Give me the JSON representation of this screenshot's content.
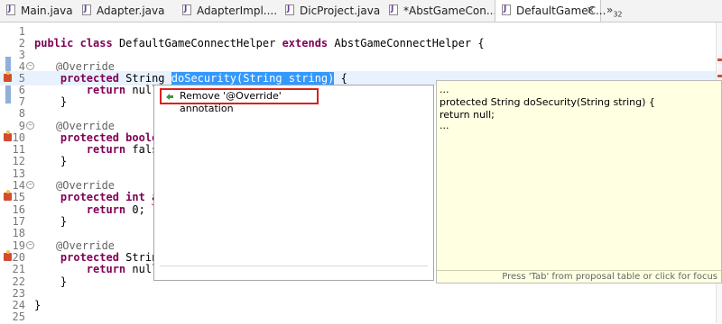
{
  "tabs": [
    {
      "label": "Main.java"
    },
    {
      "label": "Adapter.java"
    },
    {
      "label": "AdapterImpl...."
    },
    {
      "label": "DicProject.java"
    },
    {
      "label": "*AbstGameCon..."
    },
    {
      "label": "DefaultGameC...",
      "active": true
    }
  ],
  "tab_overflow": {
    "symbol": "»",
    "count": "32"
  },
  "editor": {
    "line_numbers": [
      "1",
      "2",
      "3",
      "4",
      "5",
      "6",
      "7",
      "8",
      "9",
      "10",
      "11",
      "12",
      "13",
      "14",
      "15",
      "16",
      "17",
      "18",
      "19",
      "20",
      "21",
      "22",
      "23",
      "24",
      "25"
    ],
    "l2": {
      "kw1": "public",
      "kw2": "class",
      "name": "DefaultGameConnectHelper",
      "kw3": "extends",
      "rest": "AbstGameConnectHelper {"
    },
    "l4": "@Override",
    "l5": {
      "kw": "protected",
      "type": "String",
      "selected": "doSecurity(String string)",
      "rest": " {"
    },
    "l6": {
      "kw": "return",
      "rest": "null;"
    },
    "l7": "}",
    "l9": "@Override",
    "l10": {
      "kw": "protected",
      "kw2": "boolean"
    },
    "l11": {
      "kw": "return",
      "rest": "false;"
    },
    "l12": "}",
    "l14": "@Override",
    "l15": {
      "kw": "protected",
      "kw2": "int",
      "rest": "aut"
    },
    "l16": {
      "kw": "return",
      "rest": "0;"
    },
    "l17": "}",
    "l19": "@Override",
    "l20": {
      "kw": "protected",
      "type": "String"
    },
    "l21": {
      "kw": "return",
      "rest": "null;"
    },
    "l22": "}",
    "l24": "}"
  },
  "quickfix": {
    "item": "Remove '@Override' annotation"
  },
  "preview": {
    "lines": [
      "...",
      "protected String doSecurity(String string) {",
      "return null;",
      "..."
    ],
    "status": "Press 'Tab' from proposal table or click for focus"
  },
  "colors": {
    "keyword": "#7f0055",
    "annotation": "#646464",
    "selection": "#3399ff",
    "highlight_box": "#d9201e",
    "preview_bg": "#ffffe1"
  }
}
